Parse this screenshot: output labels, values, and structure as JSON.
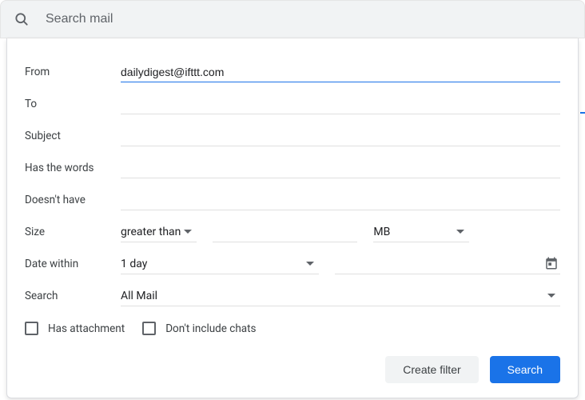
{
  "searchbar": {
    "placeholder": "Search mail"
  },
  "labels": {
    "from": "From",
    "to": "To",
    "subject": "Subject",
    "has_words": "Has the words",
    "doesnt_have": "Doesn't have",
    "size": "Size",
    "date_within": "Date within",
    "search": "Search"
  },
  "values": {
    "from": "dailydigest@ifttt.com",
    "to": "",
    "subject": "",
    "has_words": "",
    "doesnt_have": "",
    "size_op": "greater than",
    "size_value": "",
    "size_unit": "MB",
    "date_within": "1 day",
    "date_value": "",
    "search_in": "All Mail"
  },
  "checkboxes": {
    "has_attachment": "Has attachment",
    "dont_include_chats": "Don't include chats"
  },
  "buttons": {
    "create_filter": "Create filter",
    "search": "Search"
  }
}
